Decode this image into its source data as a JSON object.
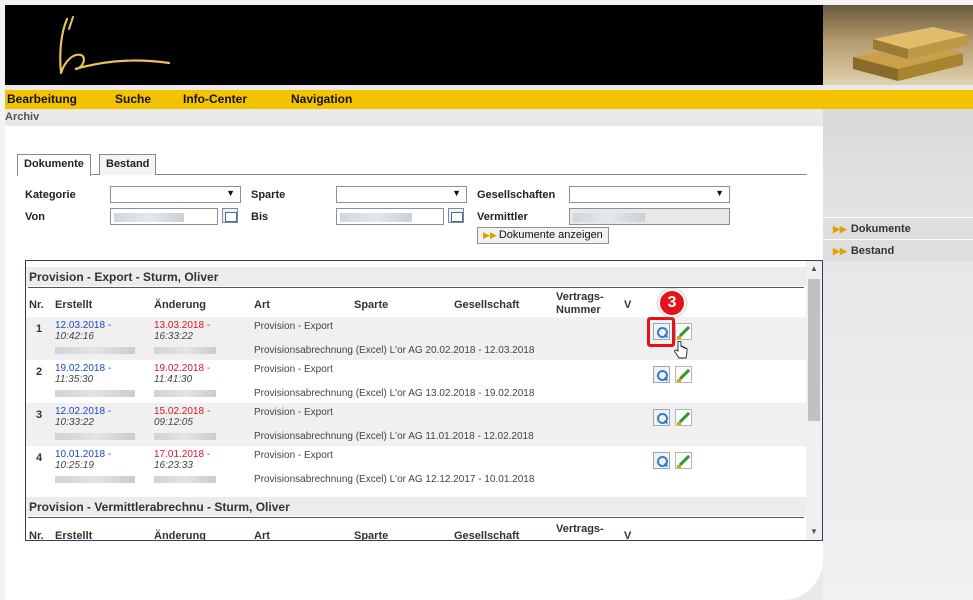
{
  "menu": {
    "items": [
      "Bearbeitung",
      "Suche",
      "Info-Center",
      "Navigation"
    ]
  },
  "breadcrumb": "Archiv",
  "tabs": [
    {
      "label": "Dokumente",
      "active": true
    },
    {
      "label": "Bestand",
      "active": false
    }
  ],
  "filters": {
    "kategorie_label": "Kategorie",
    "sparte_label": "Sparte",
    "gesellschaften_label": "Gesellschaften",
    "von_label": "Von",
    "bis_label": "Bis",
    "vermittler_label": "Vermittler",
    "show_button": "Dokumente anzeigen"
  },
  "sidenav": [
    "Dokumente",
    "Bestand"
  ],
  "columns": {
    "nr": "Nr.",
    "erstellt": "Erstellt",
    "aenderung": "Änderung",
    "art": "Art",
    "sparte": "Sparte",
    "gesellschaft": "Gesellschaft",
    "vertrag_line1": "Vertrags-",
    "vertrag_line2": "Nummer",
    "v": "V"
  },
  "sections": [
    {
      "title": "Provision - Export - Sturm, Oliver",
      "rows": [
        {
          "nr": "1",
          "created_date": "12.03.2018",
          "created_time": "10:42:16",
          "changed_date": "13.03.2018",
          "changed_time": "16:33:22",
          "art": "Provision - Export",
          "description": "Provisionsabrechnung (Excel) L'or AG 20.02.2018 - 12.03.2018"
        },
        {
          "nr": "2",
          "created_date": "19.02.2018",
          "created_time": "11:35:30",
          "changed_date": "19.02.2018",
          "changed_time": "11:41:30",
          "art": "Provision - Export",
          "description": "Provisionsabrechnung (Excel) L'or AG 13.02.2018 - 19.02.2018"
        },
        {
          "nr": "3",
          "created_date": "12.02.2018",
          "created_time": "10:33:22",
          "changed_date": "15.02.2018",
          "changed_time": "09:12:05",
          "art": "Provision - Export",
          "description": "Provisionsabrechnung (Excel) L'or AG 11.01.2018 - 12.02.2018"
        },
        {
          "nr": "4",
          "created_date": "10.01.2018",
          "created_time": "10:25:19",
          "changed_date": "17.01.2018",
          "changed_time": "16:23:33",
          "art": "Provision - Export",
          "description": "Provisionsabrechnung (Excel) L'or AG 12.12.2017 - 10.01.2018"
        }
      ]
    },
    {
      "title": "Provision - Vermittlerabrechnu - Sturm, Oliver"
    }
  ],
  "step_badge": "3",
  "colors": {
    "menubar": "#f3c300",
    "accent_red": "#e3121b",
    "created_blue": "#1f46c8",
    "changed_red": "#d7142a"
  }
}
